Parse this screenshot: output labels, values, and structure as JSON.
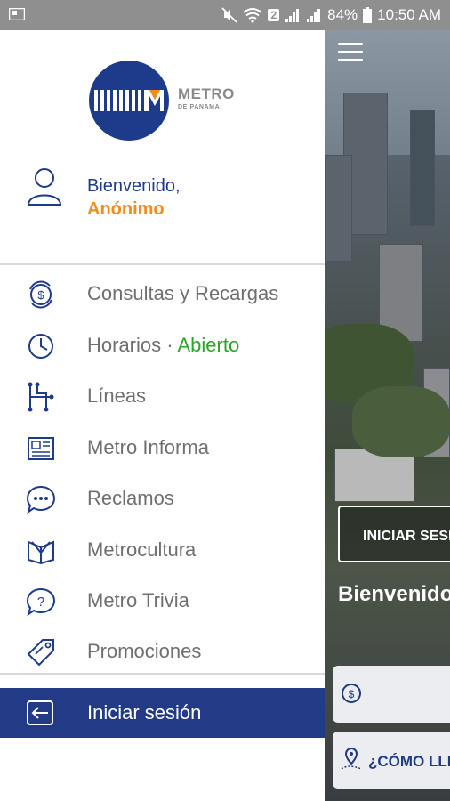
{
  "status_bar": {
    "battery": "84%",
    "time": "10:50 AM",
    "sim_badge": "2"
  },
  "background_app": {
    "login_button": "INICIAR SESIÓN",
    "welcome": "Bienvenido",
    "card_2_label": "¿CÓMO LLEGAR?"
  },
  "drawer": {
    "logo": {
      "title": "METRO",
      "subtitle": "DE PANAMA"
    },
    "user": {
      "greeting": "Bienvenido,",
      "name": "Anónimo"
    },
    "menu": [
      {
        "label": "Consultas y Recargas",
        "icon": "coin-exchange-icon"
      },
      {
        "label": "Horarios",
        "separator": " · ",
        "status": "Abierto",
        "icon": "clock-icon"
      },
      {
        "label": "Líneas",
        "icon": "lines-map-icon"
      },
      {
        "label": "Metro Informa",
        "icon": "newspaper-icon"
      },
      {
        "label": "Reclamos",
        "icon": "chat-bubble-icon"
      },
      {
        "label": "Metrocultura",
        "icon": "book-icon"
      },
      {
        "label": "Metro Trivia",
        "icon": "question-bubble-icon"
      },
      {
        "label": "Promociones",
        "icon": "tag-icon"
      }
    ],
    "login": {
      "label": "Iniciar sesión",
      "icon": "login-arrow-icon"
    }
  },
  "colors": {
    "brand_blue": "#1e3a8a",
    "accent_orange": "#f28c1c",
    "open_green": "#2aa52a",
    "login_bar": "#233a86"
  }
}
